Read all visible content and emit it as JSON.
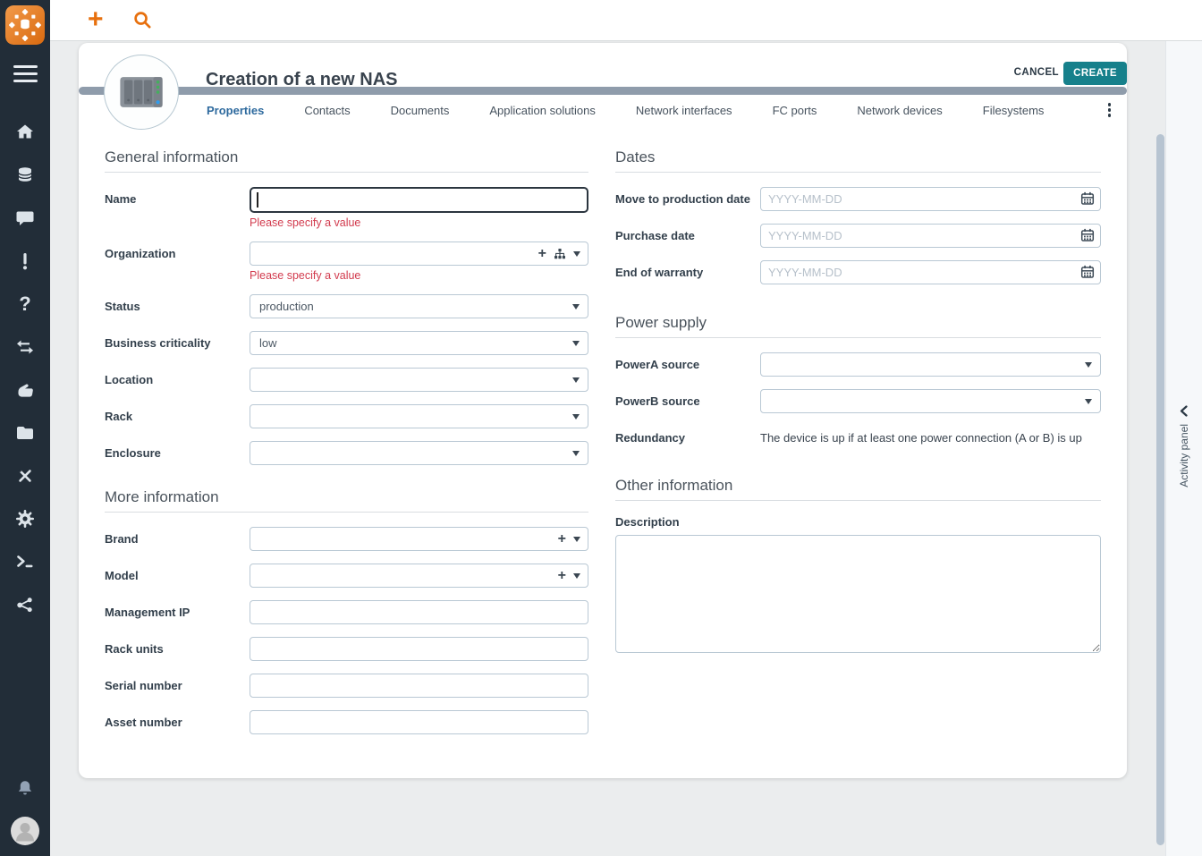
{
  "icons": {
    "add_glyph": "+",
    "help_glyph": "?",
    "search-icon": "magnifier",
    "menu-icon": "hamburger",
    "home-icon": "house",
    "data-icon": "database-cylinder",
    "chat-icon": "speech-bubble",
    "incident-icon": "exclamation-mark",
    "help-icon": "question-mark",
    "changes-icon": "double-transfer-arrows",
    "services-icon": "hand",
    "configuration-icon": "folder",
    "tools-icon": "crossed-tools",
    "settings-icon": "gear",
    "console-icon": "terminal-prompt",
    "share-icon": "share-nodes",
    "notifications-icon": "bell",
    "user-icon": "person-avatar",
    "calendar-icon": "calendar",
    "org-tree-icon": "hierarchy",
    "dropdown-icon": "caret-down",
    "more-icon": "kebab-vertical",
    "collapse-icon": "chevron-left",
    "nas-icon": "nas-device"
  },
  "header": {
    "title": "Creation of a new NAS",
    "cancel": "CANCEL",
    "create": "CREATE"
  },
  "tabs": [
    {
      "label": "Properties",
      "active": true
    },
    {
      "label": "Contacts",
      "active": false
    },
    {
      "label": "Documents",
      "active": false
    },
    {
      "label": "Application solutions",
      "active": false
    },
    {
      "label": "Network interfaces",
      "active": false
    },
    {
      "label": "FC ports",
      "active": false
    },
    {
      "label": "Network devices",
      "active": false
    },
    {
      "label": "Filesystems",
      "active": false
    }
  ],
  "form": {
    "general": {
      "title": "General information",
      "name_label": "Name",
      "name_value": "",
      "name_error": "Please specify a value",
      "organization_label": "Organization",
      "organization_value": "",
      "organization_error": "Please specify a value",
      "status_label": "Status",
      "status_value": "production",
      "criticality_label": "Business criticality",
      "criticality_value": "low",
      "location_label": "Location",
      "location_value": "",
      "rack_label": "Rack",
      "rack_value": "",
      "enclosure_label": "Enclosure",
      "enclosure_value": ""
    },
    "dates": {
      "title": "Dates",
      "move_label": "Move to production date",
      "purchase_label": "Purchase date",
      "warranty_label": "End of warranty",
      "date_placeholder": "YYYY-MM-DD"
    },
    "power": {
      "title": "Power supply",
      "powera_label": "PowerA source",
      "powera_value": "",
      "powerb_label": "PowerB source",
      "powerb_value": "",
      "redundancy_label": "Redundancy",
      "redundancy_text": "The device is up if at least one power connection (A or B) is up"
    },
    "more": {
      "title": "More information",
      "brand_label": "Brand",
      "model_label": "Model",
      "mgmtip_label": "Management IP",
      "rackunits_label": "Rack units",
      "serial_label": "Serial number",
      "asset_label": "Asset number"
    },
    "other": {
      "title": "Other information",
      "description_label": "Description",
      "description_value": ""
    }
  },
  "activity_panel": {
    "label": "Activity panel"
  },
  "colors": {
    "accent_orange": "#e7700e",
    "create_teal": "#16808b",
    "error_red": "#d23b4e",
    "active_tab_blue": "#2e6a9e",
    "sidebar_bg": "#222d38",
    "bar_gray": "#8f9cab"
  }
}
